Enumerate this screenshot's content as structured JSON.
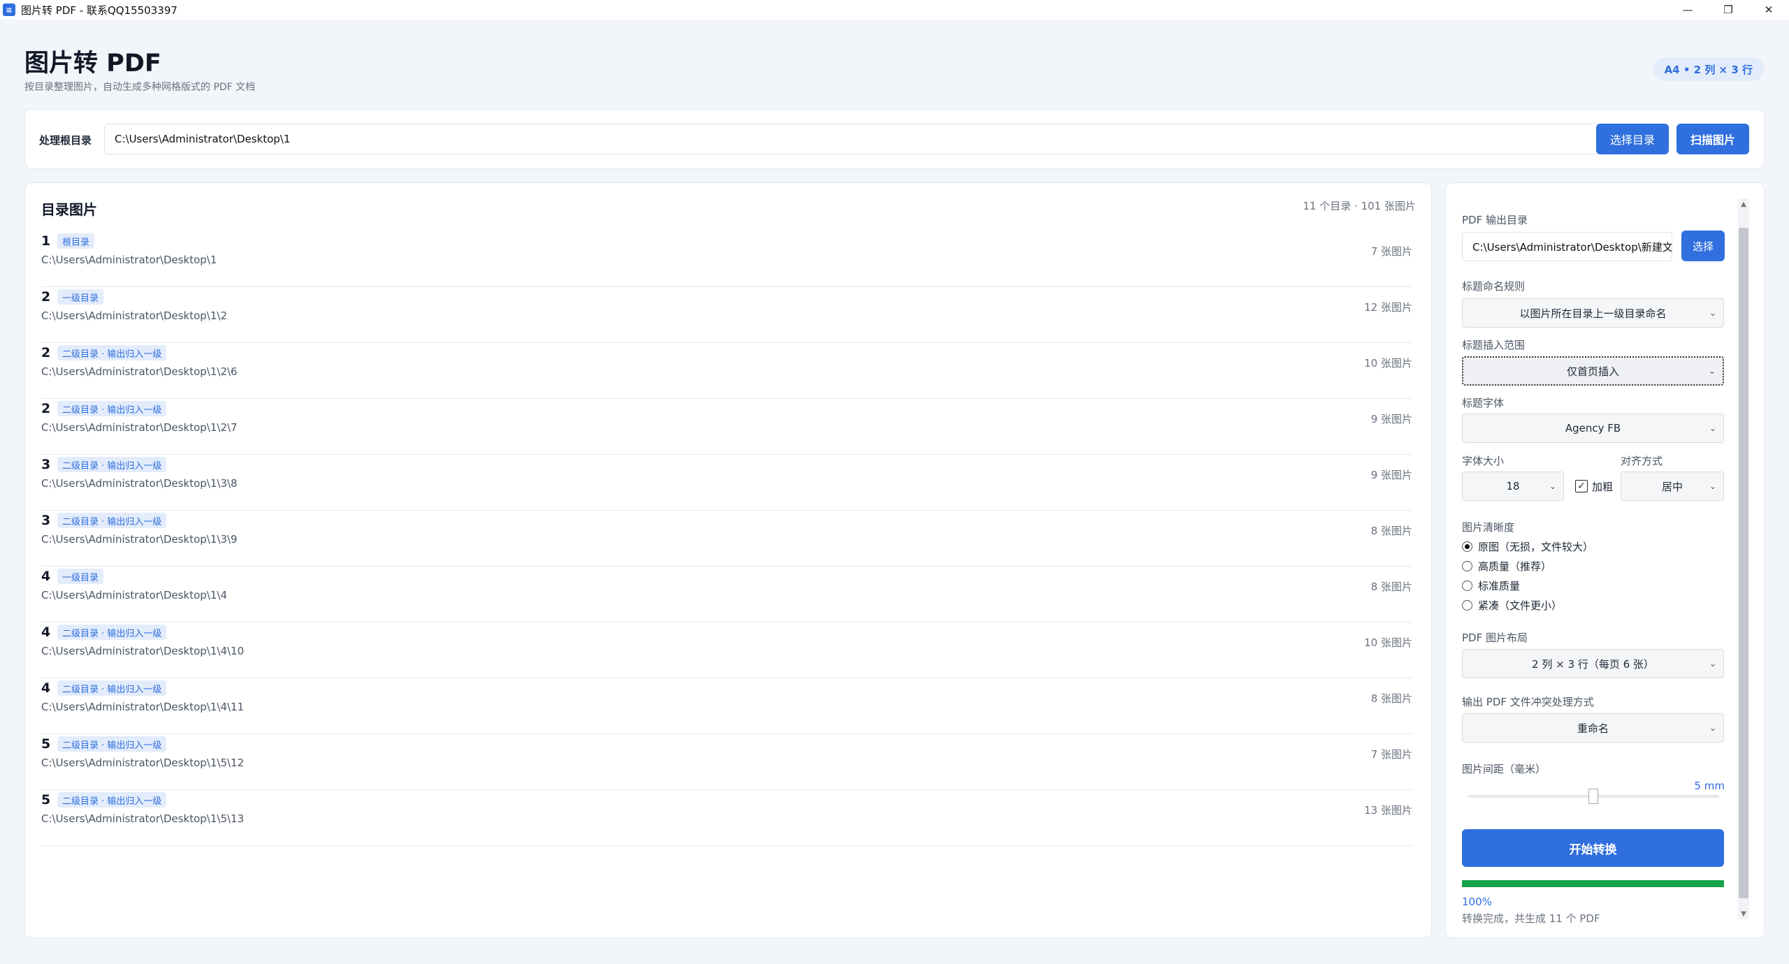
{
  "window": {
    "title": "图片转 PDF - 联系QQ15503397",
    "app_icon": "pdf-app-icon",
    "minimize_icon": "minimize-icon",
    "maximize_icon": "restore-icon",
    "close_icon": "close-icon"
  },
  "header": {
    "title": "图片转 PDF",
    "subtitle": "按目录整理图片，自动生成多种网格版式的 PDF 文档",
    "badge": "A4 • 2 列 × 3 行"
  },
  "root": {
    "label": "处理根目录",
    "path": "C:\\Users\\Administrator\\Desktop\\1",
    "choose_label": "选择目录",
    "scan_label": "扫描图片"
  },
  "directory_list": {
    "title": "目录图片",
    "summary": "11 个目录 · 101 张图片",
    "rows": [
      {
        "level": "1",
        "tag": "根目录",
        "path": "C:\\Users\\Administrator\\Desktop\\1",
        "count": "7 张图片"
      },
      {
        "level": "2",
        "tag": "一级目录",
        "path": "C:\\Users\\Administrator\\Desktop\\1\\2",
        "count": "12 张图片"
      },
      {
        "level": "2",
        "tag": "二级目录 · 输出归入一级",
        "path": "C:\\Users\\Administrator\\Desktop\\1\\2\\6",
        "count": "10 张图片"
      },
      {
        "level": "2",
        "tag": "二级目录 · 输出归入一级",
        "path": "C:\\Users\\Administrator\\Desktop\\1\\2\\7",
        "count": "9 张图片"
      },
      {
        "level": "3",
        "tag": "二级目录 · 输出归入一级",
        "path": "C:\\Users\\Administrator\\Desktop\\1\\3\\8",
        "count": "9 张图片"
      },
      {
        "level": "3",
        "tag": "二级目录 · 输出归入一级",
        "path": "C:\\Users\\Administrator\\Desktop\\1\\3\\9",
        "count": "8 张图片"
      },
      {
        "level": "4",
        "tag": "一级目录",
        "path": "C:\\Users\\Administrator\\Desktop\\1\\4",
        "count": "8 张图片"
      },
      {
        "level": "4",
        "tag": "二级目录 · 输出归入一级",
        "path": "C:\\Users\\Administrator\\Desktop\\1\\4\\10",
        "count": "10 张图片"
      },
      {
        "level": "4",
        "tag": "二级目录 · 输出归入一级",
        "path": "C:\\Users\\Administrator\\Desktop\\1\\4\\11",
        "count": "8 张图片"
      },
      {
        "level": "5",
        "tag": "二级目录 · 输出归入一级",
        "path": "C:\\Users\\Administrator\\Desktop\\1\\5\\12",
        "count": "7 张图片"
      },
      {
        "level": "5",
        "tag": "二级目录 · 输出归入一级",
        "path": "C:\\Users\\Administrator\\Desktop\\1\\5\\13",
        "count": "13 张图片"
      }
    ]
  },
  "settings": {
    "output_dir_label": "PDF 输出目录",
    "output_dir_value": "C:\\Users\\Administrator\\Desktop\\新建文",
    "output_dir_button": "选择",
    "title_rule_label": "标题命名规则",
    "title_rule_value": "以图片所在目录上一级目录命名",
    "title_scope_label": "标题插入范围",
    "title_scope_value": "仅首页插入",
    "title_font_label": "标题字体",
    "title_font_value": "Agency FB",
    "font_size_label": "字体大小",
    "font_size_value": "18",
    "bold_label": "加粗",
    "bold_checked": true,
    "align_label": "对齐方式",
    "align_value": "居中",
    "quality_label": "图片清晰度",
    "quality_options": [
      "原图（无损，文件较大）",
      "高质量（推荐）",
      "标准质量",
      "紧凑（文件更小）"
    ],
    "quality_selected": "原图（无损，文件较大）",
    "layout_label": "PDF 图片布局",
    "layout_value": "2 列 × 3 行（每页 6 张）",
    "conflict_label": "输出 PDF 文件冲突处理方式",
    "conflict_value": "重命名",
    "spacing_label": "图片间距（毫米）",
    "spacing_value": "5 mm",
    "spacing_fraction": 0.5,
    "start_label": "开始转换",
    "progress_percent": 100,
    "progress_label": "100%",
    "status": "转换完成，共生成 11 个 PDF"
  },
  "colors": {
    "accent": "#2f6fde",
    "progress": "#16a34a",
    "background": "#f2f5f9"
  }
}
